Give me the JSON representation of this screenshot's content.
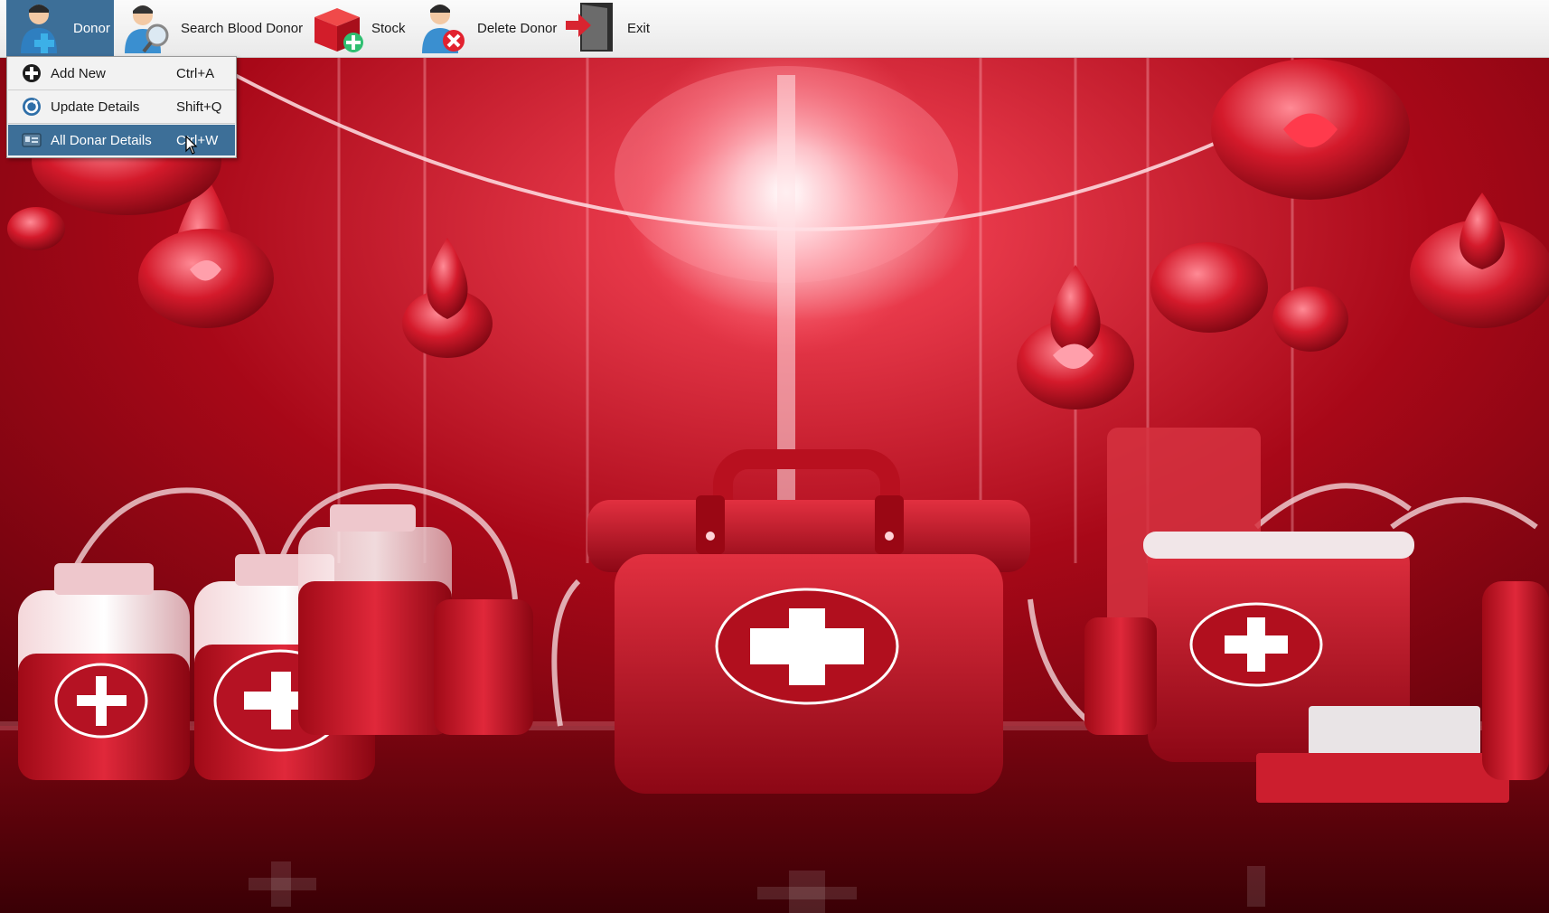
{
  "menubar": {
    "items": [
      {
        "label": "Donor",
        "icon": "donor-add-icon",
        "active": true
      },
      {
        "label": "Search Blood Donor",
        "icon": "search-donor-icon"
      },
      {
        "label": "Stock",
        "icon": "stock-icon"
      },
      {
        "label": "Delete Donor",
        "icon": "delete-donor-icon"
      },
      {
        "label": "Exit",
        "icon": "exit-door-icon"
      }
    ]
  },
  "dropdown": {
    "items": [
      {
        "label": "Add New",
        "shortcut": "Ctrl+A",
        "icon": "add-circle-icon"
      },
      {
        "label": "Update Details",
        "shortcut": "Shift+Q",
        "icon": "update-icon"
      },
      {
        "label": "All Donar Details",
        "shortcut": "Ctrl+W",
        "icon": "details-card-icon",
        "highlighted": true
      }
    ]
  },
  "colors": {
    "menu_active": "#3d6f98",
    "menubar_bg": "#f0f0f0",
    "blood_red": "#c0101e",
    "dark_red": "#5a0008"
  }
}
